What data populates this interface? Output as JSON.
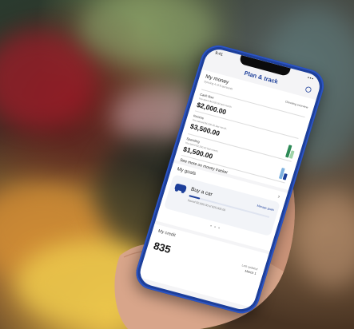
{
  "status_bar": {
    "time": "9:41",
    "signal": "▪▪▪"
  },
  "app": {
    "title": "Plan & track"
  },
  "money": {
    "title": "My money",
    "subtitle": "Syncing 4 of 8 accounts",
    "overview_link": "Checking overview",
    "cash_flow": {
      "label": "Cash flow",
      "note": "You spent $4,200.00 last month.",
      "amount": "$2,000.00"
    },
    "income": {
      "label": "Income",
      "note": "You earned $4,200.00 last month.",
      "amount": "$3,500.00"
    },
    "spending": {
      "label": "Spending",
      "note": "You spent $2,200.00 last month.",
      "amount": "$1,500.00"
    },
    "see_more": "See more on money tracker"
  },
  "goals": {
    "title": "My goals",
    "chevron": "›",
    "goal_name": "Buy a car",
    "manage_link": "Manage goals",
    "saved_text": "Saved $2,000.00 of $15,000.00",
    "progress": 0.13,
    "pager": "• • •"
  },
  "credit": {
    "title": "My credit",
    "score": "835",
    "updated_label": "Last updated",
    "updated_date": "March 1"
  },
  "colors": {
    "brand": "#1d3f9a",
    "income_bar": "#2e8b57",
    "spending_bar": "#7fb2e0"
  }
}
